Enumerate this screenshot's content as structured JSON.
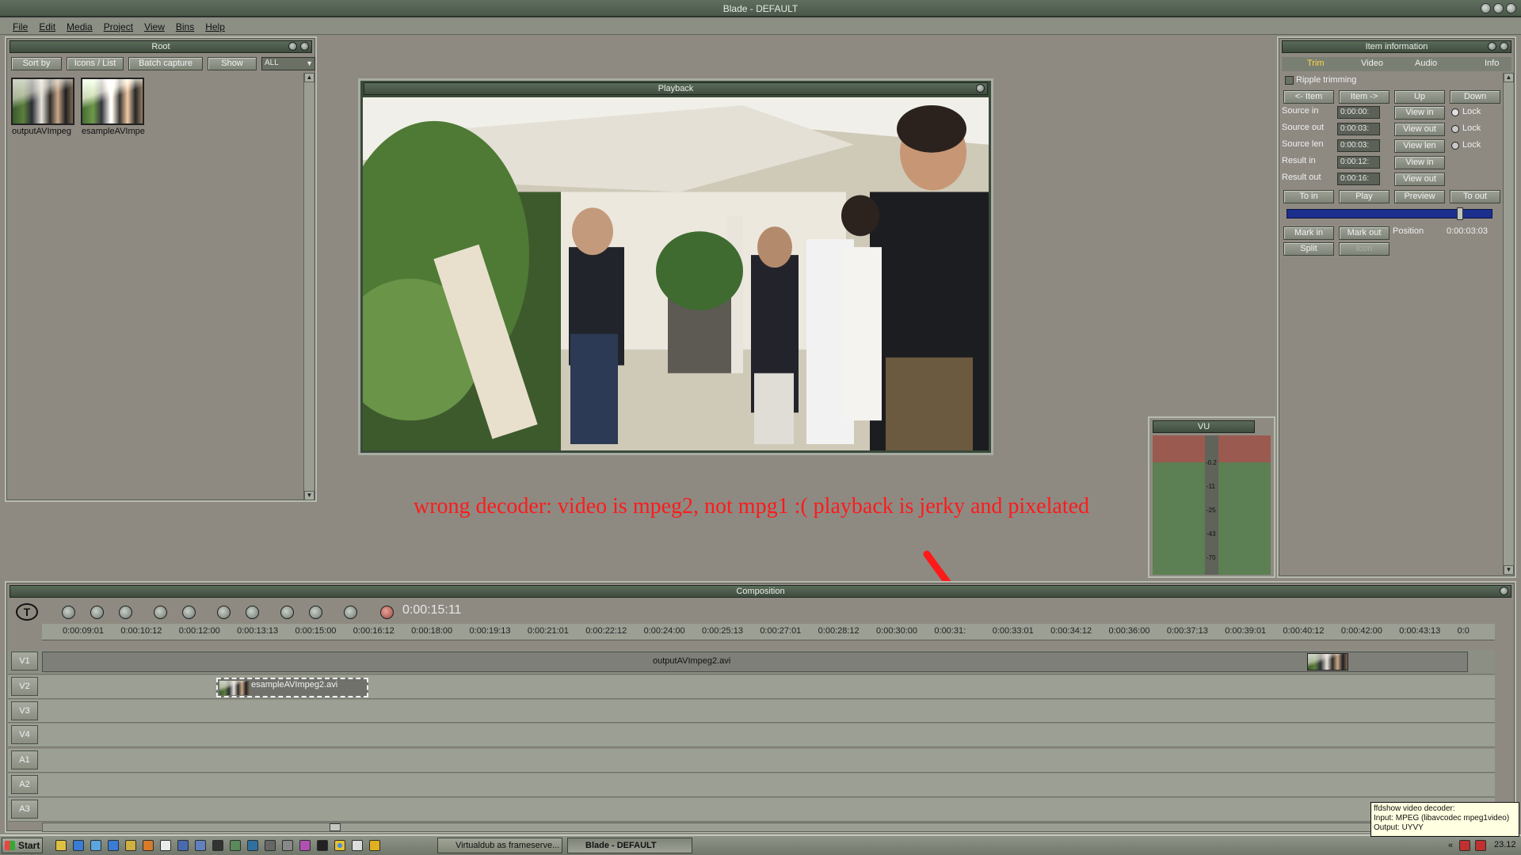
{
  "window": {
    "title": "Blade - DEFAULT"
  },
  "menu": [
    "File",
    "Edit",
    "Media",
    "Project",
    "View",
    "Bins",
    "Help"
  ],
  "root_panel": {
    "title": "Root",
    "buttons": [
      "Sort by",
      "Icons / List",
      "Batch capture",
      "Show"
    ],
    "filter_value": "ALL",
    "items": [
      {
        "name": "outputAVImpeg"
      },
      {
        "name": "esampleAVImpe"
      }
    ]
  },
  "playback": {
    "title": "Playback"
  },
  "item_info": {
    "title": "Item information",
    "tabs": [
      "Trim",
      "Video",
      "Audio",
      "Info"
    ],
    "ripple_label": "Ripple trimming",
    "nav_buttons": [
      "<- Item",
      "Item ->",
      "Up",
      "Down"
    ],
    "rows": [
      {
        "label": "Source in",
        "value": "0:00:00:",
        "button": "View in",
        "lock": "Lock"
      },
      {
        "label": "Source out",
        "value": "0:00:03:",
        "button": "View out",
        "lock": "Lock"
      },
      {
        "label": "Source len",
        "value": "0:00:03:",
        "button": "View len",
        "lock": "Lock"
      },
      {
        "label": "Result in",
        "value": "0:00:12:",
        "button": "View in"
      },
      {
        "label": "Result out",
        "value": "0:00:16:",
        "button": "View out"
      }
    ],
    "transport": [
      "To in",
      "Play",
      "Preview",
      "To out"
    ],
    "mark_in": "Mark in",
    "mark_out": "Mark out",
    "position_label": "Position",
    "position_value": "0:00:03:03",
    "split": "Split",
    "icon": "Icon",
    "slider_position": 0.85
  },
  "annotation": "wrong decoder: video is mpeg2, not mpg1 :( playback is jerky and pixelated",
  "vu": {
    "title": "VU",
    "scale": [
      "-0.2",
      "-11",
      "-25",
      "-43",
      "-70"
    ]
  },
  "composition": {
    "title": "Composition",
    "timecode": "0:00:15:11",
    "ruler": [
      "0:00:09:01",
      "0:00:10:12",
      "0:00:12:00",
      "0:00:13:13",
      "0:00:15:00",
      "0:00:16:12",
      "0:00:18:00",
      "0:00:19:13",
      "0:00:21:01",
      "0:00:22:12",
      "0:00:24:00",
      "0:00:25:13",
      "0:00:27:01",
      "0:00:28:12",
      "0:00:30:00",
      "0:00:31:",
      "0:00:33:01",
      "0:00:34:12",
      "0:00:36:00",
      "0:00:37:13",
      "0:00:39:01",
      "0:00:40:12",
      "0:00:42:00",
      "0:00:43:13",
      "0:0"
    ],
    "video_tracks": [
      "V1",
      "V2",
      "V3",
      "V4"
    ],
    "audio_tracks": [
      "A1",
      "A2",
      "A3"
    ],
    "clips": [
      {
        "track": "V1",
        "name": "outputAVImpeg2.avi"
      },
      {
        "track": "V2",
        "name": "esampleAVImpeg2.avi"
      }
    ]
  },
  "taskbar": {
    "start": "Start",
    "items": [
      "Virtualdub as frameserve...",
      "Blade - DEFAULT"
    ],
    "clock": "23.12"
  },
  "tooltip": {
    "lines": [
      "ffdshow video decoder:",
      "Input: MPEG (libavcodec mpeg1video)",
      "Output: UYVY"
    ]
  },
  "colors": {
    "panel_bg": "#8e8a82",
    "title_green": "#4a584a",
    "annotation_red": "#ff1a1a",
    "slider_blue": "#1c2f8c",
    "vu_green": "#5c7f53",
    "vu_red": "#9b5a4f"
  }
}
